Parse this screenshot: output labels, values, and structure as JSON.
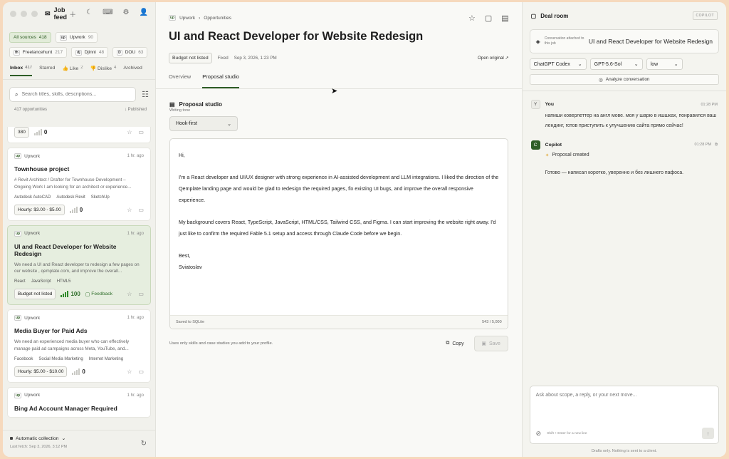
{
  "sidebar": {
    "app_title": "Job feed",
    "source_chips": [
      {
        "label": "All sources",
        "count": "418",
        "active": true,
        "icon": ""
      },
      {
        "label": "Upwork",
        "count": "90",
        "icon": "up"
      },
      {
        "label": "Freelancehunt",
        "count": "217",
        "icon": "fh"
      },
      {
        "label": "Djinni",
        "count": "48",
        "icon": "dj"
      },
      {
        "label": "DOU",
        "count": "63",
        "icon": "D"
      }
    ],
    "tabs": [
      {
        "label": "Inbox",
        "count": "417",
        "active": true
      },
      {
        "label": "Starred",
        "count": ""
      },
      {
        "label": "👍 Like",
        "count": "2"
      },
      {
        "label": "👎 Dislike",
        "count": "4"
      },
      {
        "label": "Archived",
        "count": ""
      }
    ],
    "search_placeholder": "Search titles, skills, descriptions...",
    "opportunities_count": "417 opportunities",
    "sort_label": "↓ Published",
    "partial_card": {
      "badge": "380",
      "score": "0"
    },
    "cards": [
      {
        "source_icon": "up",
        "source": "Upwork",
        "time": "1 hr. ago",
        "title": "Townhouse project",
        "desc": "# Revit Architect / Drafter for Townhouse Development – Ongoing Work I am looking for an architect or experience...",
        "tags": [
          "Autodesk AutoCAD",
          "Autodesk Revit",
          "SketchUp"
        ],
        "badge": "Hourly: $3.00 - $5.00",
        "score": "0",
        "selected": false
      },
      {
        "source_icon": "up",
        "source": "Upwork",
        "time": "1 hr. ago",
        "title": "UI and React Developer for Website Redesign",
        "desc": "We need a UI and React developer to redesign a few pages on our website , qemplate.com, and improve the overall...",
        "tags": [
          "React",
          "JavaScript",
          "HTML5"
        ],
        "badge": "Budget not listed",
        "score": "100",
        "feedback": "Feedback",
        "selected": true
      },
      {
        "source_icon": "up",
        "source": "Upwork",
        "time": "1 hr. ago",
        "title": "Media Buyer for Paid Ads",
        "desc": "We need an experienced media buyer who can effectively manage paid ad campaigns across Meta, YouTube, and...",
        "tags": [
          "Facebook",
          "Social Media Marketing",
          "Internet Marketing"
        ],
        "badge": "Hourly: $5.00 - $10.00",
        "score": "0",
        "selected": false
      },
      {
        "source_icon": "up",
        "source": "Upwork",
        "time": "1 hr. ago",
        "title": "Bing Ad Account Manager Required",
        "desc": "",
        "tags": [],
        "badge": "",
        "score": "",
        "selected": false
      }
    ],
    "collection_label": "Automatic collection",
    "last_fetch": "Last fetch: Sep 3, 2026, 3:12 PM"
  },
  "main": {
    "breadcrumb": {
      "source_icon": "up",
      "source": "Upwork",
      "page": "Opportunities"
    },
    "title": "UI and React Developer for Website Redesign",
    "meta": {
      "badge": "Budget not listed",
      "type": "Fixed",
      "date": "Sep 3, 2026, 1:23 PM",
      "open_original": "Open original ↗"
    },
    "tabs": [
      {
        "label": "Overview",
        "active": false
      },
      {
        "label": "Proposal studio",
        "active": true
      }
    ],
    "studio": {
      "title": "Proposal studio",
      "tone_label": "Writing tone",
      "tone_value": "Hook-first",
      "paragraphs": [
        "Hi,",
        "I'm a React developer and UI/UX designer with strong experience in AI-assisted development and LLM integrations. I liked the direction of the Qemplate landing page and would be glad to redesign the required pages, fix existing UI bugs, and improve the overall responsive experience.",
        "My background covers React, TypeScript, JavaScript, HTML/CSS, Tailwind CSS, and Figma. I can start improving the website right away. I'd just like to confirm the required Fable 5.1 setup and access through Claude Code before we begin.",
        "Best,\nSviatoslav"
      ],
      "saved_status": "Saved to SQLite",
      "char_count": "543 / 5,000",
      "note": "Uses only skills and case studies you add to your profile.",
      "copy_label": "Copy",
      "save_label": "Save"
    }
  },
  "deal_room": {
    "title": "Deal room",
    "tag": "COPILOT",
    "conversation_label": "Conversation attached to this job",
    "conversation_title": "UI and React Developer for Website Redesign",
    "selects": [
      "ChatGPT Codex",
      "GPT-5.6-Sol",
      "low"
    ],
    "analyze_label": "Analyze conversation",
    "messages": [
      {
        "avatar": "Y",
        "author": "You",
        "time": "01:28 PM",
        "text": "напиши коверлеттер на англ мове. моя у шарю в ишшках, понравился ваш лендинг, готов приступить к улучшению сайта прямо сейчас!"
      },
      {
        "avatar": "C",
        "author": "Copilot",
        "time": "01:28 PM",
        "status": "Proposal created",
        "text": "Готово — написал коротко, уверенно и без лишнего пафоса."
      }
    ],
    "composer_placeholder": "Ask about scope, a reply, or your next move...",
    "composer_hint": "Shift + Enter for a new line",
    "drafts_note": "Drafts only. Nothing is sent to a client."
  }
}
